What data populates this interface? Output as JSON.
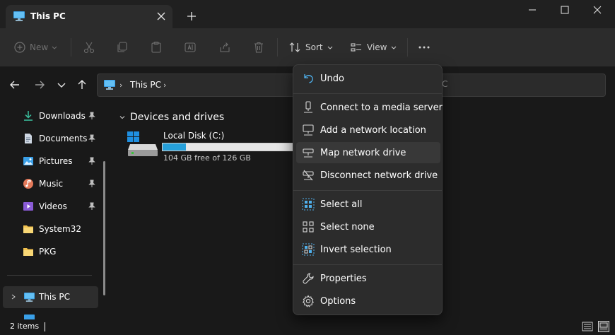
{
  "tab": {
    "title": "This PC"
  },
  "toolbar": {
    "new_label": "New",
    "sort_label": "Sort",
    "view_label": "View"
  },
  "address": {
    "crumb": "This PC",
    "search_fragment": "C"
  },
  "sidebar": {
    "items": [
      {
        "label": "Downloads",
        "icon": "download-icon",
        "pinned": true
      },
      {
        "label": "Documents",
        "icon": "document-icon",
        "pinned": true
      },
      {
        "label": "Pictures",
        "icon": "pictures-icon",
        "pinned": true
      },
      {
        "label": "Music",
        "icon": "music-icon",
        "pinned": true
      },
      {
        "label": "Videos",
        "icon": "videos-icon",
        "pinned": true
      },
      {
        "label": "System32",
        "icon": "folder-icon",
        "pinned": false
      },
      {
        "label": "PKG",
        "icon": "folder-icon",
        "pinned": false
      }
    ],
    "this_pc": "This PC"
  },
  "content": {
    "section_title": "Devices and drives",
    "drive": {
      "name": "Local Disk (C:)",
      "free_text": "104 GB free of 126 GB",
      "used_fraction": 0.175
    }
  },
  "status": {
    "items": "2 items"
  },
  "menu": {
    "items": [
      {
        "label": "Undo",
        "icon": "undo-icon"
      },
      {
        "label": "Connect to a media server",
        "icon": "media-server-icon"
      },
      {
        "label": "Add a network location",
        "icon": "network-location-icon"
      },
      {
        "label": "Map network drive",
        "icon": "map-drive-icon"
      },
      {
        "label": "Disconnect network drive",
        "icon": "disconnect-drive-icon"
      },
      {
        "label": "Select all",
        "icon": "select-all-icon"
      },
      {
        "label": "Select none",
        "icon": "select-none-icon"
      },
      {
        "label": "Invert selection",
        "icon": "invert-selection-icon"
      },
      {
        "label": "Properties",
        "icon": "properties-icon"
      },
      {
        "label": "Options",
        "icon": "options-icon"
      }
    ]
  },
  "colors": {
    "accent": "#26a0da",
    "menu_bg": "#2c2c2c",
    "window_bg": "#191919"
  }
}
